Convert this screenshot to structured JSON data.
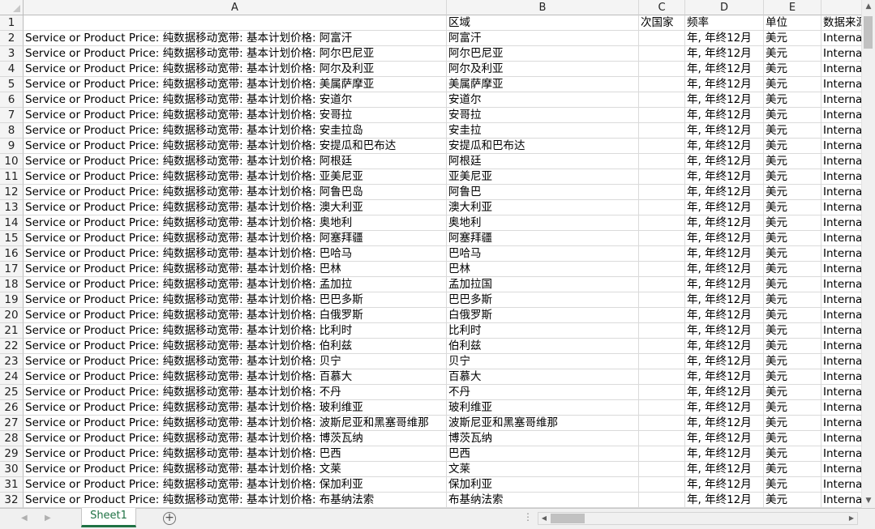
{
  "columns": [
    "A",
    "B",
    "C",
    "D",
    "E",
    ""
  ],
  "header_row": {
    "row_number": "1",
    "a": "",
    "b": "区域",
    "c": "次国家",
    "d": "频率",
    "e": "单位",
    "f": "数据来源"
  },
  "rows": [
    {
      "n": "2",
      "a": "Service or Product Price:  纯数据移动宽带:  基本计划价格:  阿富汗",
      "b": "阿富汗",
      "d": "年, 年终12月",
      "e": "美元",
      "f": "International Telecommunication Union"
    },
    {
      "n": "3",
      "a": "Service or Product Price:  纯数据移动宽带:  基本计划价格:  阿尔巴尼亚",
      "b": "阿尔巴尼亚",
      "d": "年, 年终12月",
      "e": "美元",
      "f": "International Telecommunication Union"
    },
    {
      "n": "4",
      "a": "Service or Product Price:  纯数据移动宽带:  基本计划价格:  阿尔及利亚",
      "b": "阿尔及利亚",
      "d": "年, 年终12月",
      "e": "美元",
      "f": "International Telecommunication Union"
    },
    {
      "n": "5",
      "a": "Service or Product Price:  纯数据移动宽带:  基本计划价格:  美属萨摩亚",
      "b": "美属萨摩亚",
      "d": "年, 年终12月",
      "e": "美元",
      "f": "International Telecommunication Union"
    },
    {
      "n": "6",
      "a": "Service or Product Price:  纯数据移动宽带:  基本计划价格:  安道尔",
      "b": "安道尔",
      "d": "年, 年终12月",
      "e": "美元",
      "f": "International Telecommunication Union"
    },
    {
      "n": "7",
      "a": "Service or Product Price:  纯数据移动宽带:  基本计划价格:  安哥拉",
      "b": "安哥拉",
      "d": "年, 年终12月",
      "e": "美元",
      "f": "International Telecommunication Union"
    },
    {
      "n": "8",
      "a": "Service or Product Price:  纯数据移动宽带:  基本计划价格:  安圭拉岛",
      "b": "安圭拉",
      "d": "年, 年终12月",
      "e": "美元",
      "f": "International Telecommunication Union"
    },
    {
      "n": "9",
      "a": "Service or Product Price:  纯数据移动宽带:  基本计划价格:  安提瓜和巴布达",
      "b": "安提瓜和巴布达",
      "d": "年, 年终12月",
      "e": "美元",
      "f": "International Telecommunication Union"
    },
    {
      "n": "10",
      "a": "Service or Product Price:  纯数据移动宽带:  基本计划价格:  阿根廷",
      "b": "阿根廷",
      "d": "年, 年终12月",
      "e": "美元",
      "f": "International Telecommunication Union"
    },
    {
      "n": "11",
      "a": "Service or Product Price:  纯数据移动宽带:  基本计划价格:  亚美尼亚",
      "b": "亚美尼亚",
      "d": "年, 年终12月",
      "e": "美元",
      "f": "International Telecommunication Union"
    },
    {
      "n": "12",
      "a": "Service or Product Price:  纯数据移动宽带:  基本计划价格:  阿鲁巴岛",
      "b": "阿鲁巴",
      "d": "年, 年终12月",
      "e": "美元",
      "f": "International Telecommunication Union"
    },
    {
      "n": "13",
      "a": "Service or Product Price:  纯数据移动宽带:  基本计划价格:  澳大利亚",
      "b": "澳大利亚",
      "d": "年, 年终12月",
      "e": "美元",
      "f": "International Telecommunication Union"
    },
    {
      "n": "14",
      "a": "Service or Product Price:  纯数据移动宽带:  基本计划价格:  奥地利",
      "b": "奥地利",
      "d": "年, 年终12月",
      "e": "美元",
      "f": "International Telecommunication Union"
    },
    {
      "n": "15",
      "a": "Service or Product Price:  纯数据移动宽带:  基本计划价格:  阿塞拜疆",
      "b": "阿塞拜疆",
      "d": "年, 年终12月",
      "e": "美元",
      "f": "International Telecommunication Union"
    },
    {
      "n": "16",
      "a": "Service or Product Price:  纯数据移动宽带:  基本计划价格:  巴哈马",
      "b": "巴哈马",
      "d": "年, 年终12月",
      "e": "美元",
      "f": "International Telecommunication Union"
    },
    {
      "n": "17",
      "a": "Service or Product Price:  纯数据移动宽带:  基本计划价格:  巴林",
      "b": "巴林",
      "d": "年, 年终12月",
      "e": "美元",
      "f": "International Telecommunication Union"
    },
    {
      "n": "18",
      "a": "Service or Product Price:  纯数据移动宽带:  基本计划价格:  孟加拉",
      "b": "孟加拉国",
      "d": "年, 年终12月",
      "e": "美元",
      "f": "International Telecommunication Union"
    },
    {
      "n": "19",
      "a": "Service or Product Price:  纯数据移动宽带:  基本计划价格:  巴巴多斯",
      "b": "巴巴多斯",
      "d": "年, 年终12月",
      "e": "美元",
      "f": "International Telecommunication Union"
    },
    {
      "n": "20",
      "a": "Service or Product Price:  纯数据移动宽带:  基本计划价格:  白俄罗斯",
      "b": "白俄罗斯",
      "d": "年, 年终12月",
      "e": "美元",
      "f": "International Telecommunication Union"
    },
    {
      "n": "21",
      "a": "Service or Product Price:  纯数据移动宽带:  基本计划价格:  比利时",
      "b": "比利时",
      "d": "年, 年终12月",
      "e": "美元",
      "f": "International Telecommunication Union"
    },
    {
      "n": "22",
      "a": "Service or Product Price:  纯数据移动宽带:  基本计划价格:  伯利兹",
      "b": "伯利兹",
      "d": "年, 年终12月",
      "e": "美元",
      "f": "International Telecommunication Union"
    },
    {
      "n": "23",
      "a": "Service or Product Price:  纯数据移动宽带:  基本计划价格:  贝宁",
      "b": "贝宁",
      "d": "年, 年终12月",
      "e": "美元",
      "f": "International Telecommunication Union"
    },
    {
      "n": "24",
      "a": "Service or Product Price:  纯数据移动宽带:  基本计划价格:  百慕大",
      "b": "百慕大",
      "d": "年, 年终12月",
      "e": "美元",
      "f": "International Telecommunication Union"
    },
    {
      "n": "25",
      "a": "Service or Product Price:  纯数据移动宽带:  基本计划价格:  不丹",
      "b": "不丹",
      "d": "年, 年终12月",
      "e": "美元",
      "f": "International Telecommunication Union"
    },
    {
      "n": "26",
      "a": "Service or Product Price:  纯数据移动宽带:  基本计划价格:  玻利维亚",
      "b": "玻利维亚",
      "d": "年, 年终12月",
      "e": "美元",
      "f": "International Telecommunication Union"
    },
    {
      "n": "27",
      "a": "Service or Product Price:  纯数据移动宽带:  基本计划价格:  波斯尼亚和黑塞哥维那",
      "b": "波斯尼亚和黑塞哥维那",
      "d": "年, 年终12月",
      "e": "美元",
      "f": "International Telecommunication Union"
    },
    {
      "n": "28",
      "a": "Service or Product Price:  纯数据移动宽带:  基本计划价格:  博茨瓦纳",
      "b": "博茨瓦纳",
      "d": "年, 年终12月",
      "e": "美元",
      "f": "International Telecommunication Union"
    },
    {
      "n": "29",
      "a": "Service or Product Price:  纯数据移动宽带:  基本计划价格:  巴西",
      "b": "巴西",
      "d": "年, 年终12月",
      "e": "美元",
      "f": "International Telecommunication Union"
    },
    {
      "n": "30",
      "a": "Service or Product Price:  纯数据移动宽带:  基本计划价格:  文莱",
      "b": "文莱",
      "d": "年, 年终12月",
      "e": "美元",
      "f": "International Telecommunication Union"
    },
    {
      "n": "31",
      "a": "Service or Product Price:  纯数据移动宽带:  基本计划价格:  保加利亚",
      "b": "保加利亚",
      "d": "年, 年终12月",
      "e": "美元",
      "f": "International Telecommunication Union"
    },
    {
      "n": "32",
      "a": "Service or Product Price:  纯数据移动宽带:  基本计划价格:  布基纳法索",
      "b": "布基纳法索",
      "d": "年, 年终12月",
      "e": "美元",
      "f": "International Telecommunication Union"
    }
  ],
  "footer": {
    "sheet_tab": "Sheet1",
    "add_sheet": "+",
    "nav_prev": "◀",
    "nav_next": "▶",
    "split_handle": "⋮"
  },
  "scrollbars": {
    "up": "▲",
    "down": "▼",
    "left": "◀",
    "right": "▶"
  },
  "colors": {
    "active_tab": "#1f7244",
    "header_bg": "#f4f4f4",
    "grid": "#dadada"
  }
}
